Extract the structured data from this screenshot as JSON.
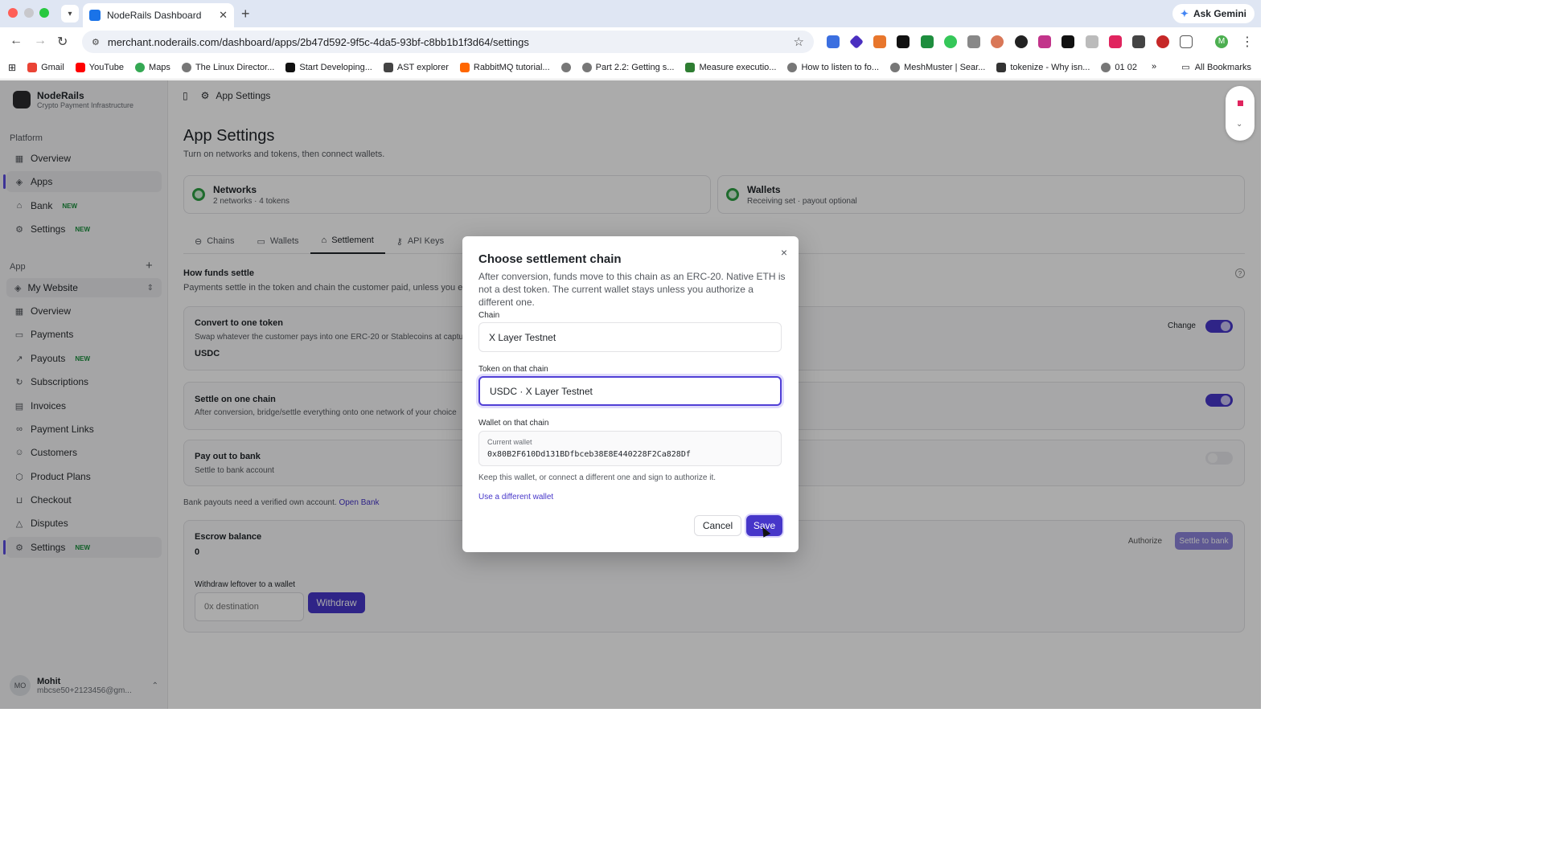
{
  "browser": {
    "tab_title": "NodeRails Dashboard",
    "url": "merchant.noderails.com/dashboard/apps/2b47d592-9f5c-4da5-93bf-c8bb1b1f3d64/settings",
    "ask_gemini": "Ask Gemini",
    "bookmarks": [
      "Gmail",
      "YouTube",
      "Maps",
      "The Linux Director...",
      "Start Developing...",
      "AST explorer",
      "RabbitMQ tutorial...",
      "",
      "Part 2.2: Getting s...",
      "Measure executio...",
      "How to listen to fo...",
      "MeshMuster | Sear...",
      "tokenize - Why isn...",
      "01 02"
    ],
    "overflow": "»",
    "all_bookmarks": "All Bookmarks",
    "profile_initial": "M"
  },
  "sidebar": {
    "brand_name": "NodeRails",
    "brand_sub": "Crypto Payment Infrastructure",
    "platform_label": "Platform",
    "platform_items": [
      {
        "label": "Overview",
        "badge": ""
      },
      {
        "label": "Apps",
        "badge": ""
      },
      {
        "label": "Bank",
        "badge": "NEW"
      },
      {
        "label": "Settings",
        "badge": "NEW"
      }
    ],
    "app_label": "App",
    "add_icon": "+",
    "app_select": "My Website",
    "app_items": [
      {
        "label": "Overview",
        "badge": ""
      },
      {
        "label": "Payments",
        "badge": ""
      },
      {
        "label": "Payouts",
        "badge": "NEW"
      },
      {
        "label": "Subscriptions",
        "badge": ""
      },
      {
        "label": "Invoices",
        "badge": ""
      },
      {
        "label": "Payment Links",
        "badge": ""
      },
      {
        "label": "Customers",
        "badge": ""
      },
      {
        "label": "Product Plans",
        "badge": ""
      },
      {
        "label": "Checkout",
        "badge": ""
      },
      {
        "label": "Disputes",
        "badge": ""
      },
      {
        "label": "Settings",
        "badge": "NEW"
      }
    ],
    "user": {
      "initials": "MO",
      "name": "Mohit",
      "email": "mbcse50+2123456@gm..."
    }
  },
  "main": {
    "breadcrumb": "App Settings",
    "title": "App Settings",
    "subtitle": "Turn on networks and tokens, then connect wallets.",
    "networks_title": "Networks",
    "networks_sub": "2 networks · 4 tokens",
    "wallets_title": "Wallets",
    "wallets_sub": "Receiving set · payout optional",
    "tabs": [
      "Chains",
      "Wallets",
      "Settlement",
      "API Keys"
    ],
    "how_title": "How funds settle",
    "how_sub": "Payments settle in the token and chain the customer paid, unless you enab",
    "convert_title": "Convert to one token",
    "convert_sub": "Swap whatever the customer pays into one ERC-20 or Stablecoins at capture",
    "convert_token": "USDC",
    "change_label": "Change",
    "settle_title": "Settle on one chain",
    "settle_sub": "After conversion, bridge/settle everything onto one network of your choice",
    "bank_title": "Pay out to bank",
    "bank_sub": "Settle to bank account",
    "bank_note": "Bank payouts need a verified own account.",
    "open_bank": "Open Bank",
    "escrow_title": "Escrow balance",
    "escrow_value": "0",
    "authorize_label": "Authorize",
    "settle_bank_label": "Settle to bank",
    "withdraw_label": "Withdraw leftover to a wallet",
    "withdraw_placeholder": "0x destination",
    "withdraw_button": "Withdraw"
  },
  "modal": {
    "title": "Choose settlement chain",
    "close": "×",
    "description": "After conversion, funds move to this chain as an ERC-20. Native ETH is not a dest token. The current wallet stays unless you authorize a different one.",
    "chain_label": "Chain",
    "chain_value": "X Layer Testnet",
    "token_label": "Token on that chain",
    "token_value": "USDC · X Layer Testnet",
    "wallet_label": "Wallet on that chain",
    "current_wallet_label": "Current wallet",
    "current_wallet": "0x80B2F610Dd131BDfbceb38E8E440228F2Ca828Df",
    "hint": "Keep this wallet, or connect a different one and sign to authorize it.",
    "different_wallet": "Use a different wallet",
    "cancel": "Cancel",
    "save": "Save"
  },
  "colors": {
    "accent": "#4636c9",
    "success": "#2ea043",
    "new_badge": "#1a8f3c"
  }
}
